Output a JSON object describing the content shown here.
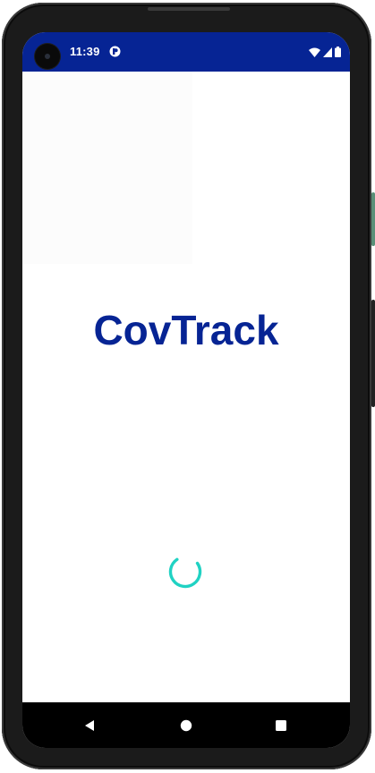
{
  "status_bar": {
    "time": "11:39",
    "background_color": "#062494",
    "notification_icon": "app-notification-icon",
    "icons": [
      "wifi-icon",
      "cellular-signal-icon",
      "battery-icon"
    ]
  },
  "splash": {
    "app_title": "CovTrack",
    "title_color": "#062494",
    "loading_indicator": "progress-spinner",
    "spinner_color": "#20d2c3"
  },
  "navigation_bar": {
    "buttons": [
      "back-icon",
      "home-icon",
      "recents-icon"
    ]
  }
}
